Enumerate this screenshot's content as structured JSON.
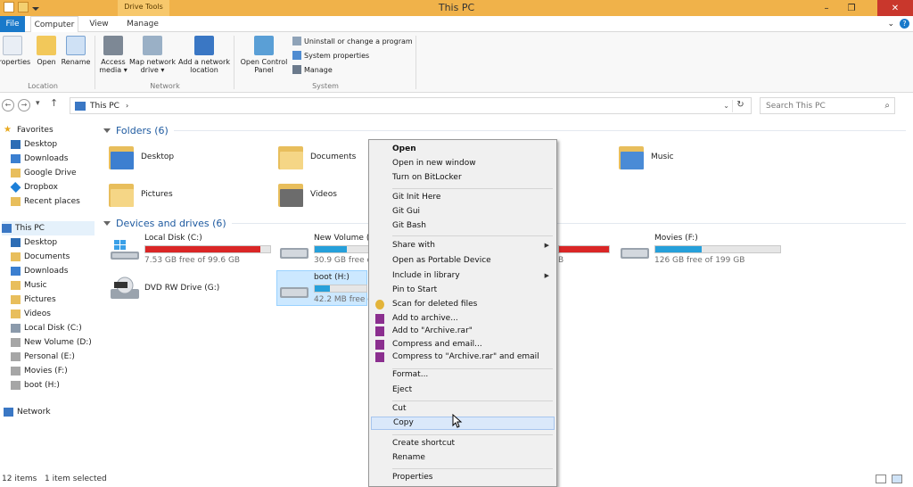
{
  "window": {
    "title": "This PC",
    "contextual_tab": "Drive Tools"
  },
  "tabs": {
    "file": "File",
    "computer": "Computer",
    "view": "View",
    "manage": "Manage"
  },
  "ribbon": {
    "properties": "Properties",
    "open": "Open",
    "rename": "Rename",
    "access_media_1": "Access",
    "access_media_2": "media ▾",
    "map_network_1": "Map network",
    "map_network_2": "drive ▾",
    "add_network_1": "Add a network",
    "add_network_2": "location",
    "open_control_1": "Open Control",
    "open_control_2": "Panel",
    "uninstall": "Uninstall or change a program",
    "system_properties": "System properties",
    "manage": "Manage",
    "group_location": "Location",
    "group_network": "Network",
    "group_system": "System"
  },
  "address": {
    "path": "This PC",
    "search_placeholder": "Search This PC"
  },
  "nav": {
    "favorites": "Favorites",
    "fav_items": [
      "Desktop",
      "Downloads",
      "Google Drive",
      "Dropbox",
      "Recent places"
    ],
    "thispc": "This PC",
    "pc_items": [
      "Desktop",
      "Documents",
      "Downloads",
      "Music",
      "Pictures",
      "Videos",
      "Local Disk (C:)",
      "New Volume (D:)",
      "Personal (E:)",
      "Movies (F:)",
      "boot (H:)"
    ],
    "network": "Network"
  },
  "content": {
    "folders_header": "Folders (6)",
    "folders": [
      "Desktop",
      "Documents",
      "Music",
      "Pictures",
      "Videos"
    ],
    "devices_header": "Devices and drives (6)",
    "drives": [
      {
        "name": "Local Disk (C:)",
        "free": "7.53 GB free of 99.6 GB",
        "used_pct": 92,
        "color": "#da2626"
      },
      {
        "name": "New Volume (D",
        "free": "30.9 GB free of",
        "used_pct": 60,
        "color": "#26a0da"
      },
      {
        "name": "Movies (F:)",
        "free": "126 GB free of 199 GB",
        "used_pct": 37,
        "color": "#26a0da"
      },
      {
        "name": "DVD RW Drive (G:)"
      },
      {
        "name": "boot (H:)",
        "free": "42.2 MB free of",
        "used_pct": 30,
        "color": "#26a0da"
      },
      {
        "free": "B"
      }
    ]
  },
  "context_menu": {
    "items": [
      "Open",
      "Open in new window",
      "Turn on BitLocker",
      "Git Init Here",
      "Git Gui",
      "Git Bash",
      "Share with",
      "Open as Portable Device",
      "Include in library",
      "Pin to Start",
      "Scan for deleted files",
      "Add to archive...",
      "Add to \"Archive.rar\"",
      "Compress and email...",
      "Compress to \"Archive.rar\" and email",
      "Format...",
      "Eject",
      "Cut",
      "Copy",
      "Create shortcut",
      "Rename",
      "Properties"
    ]
  },
  "status": {
    "items": "12 items",
    "selected": "1 item selected"
  }
}
